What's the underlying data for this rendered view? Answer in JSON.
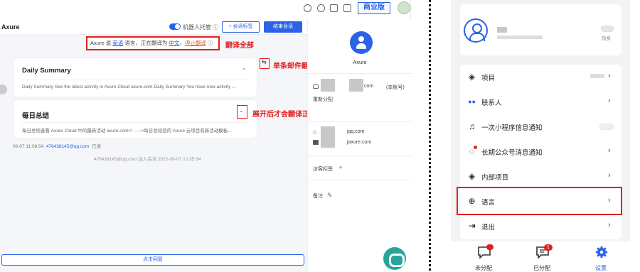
{
  "desktop": {
    "topbar": {
      "plan_button": "商业版"
    },
    "chat": {
      "title": "Axure",
      "robot_label": "机器人托管 ⓘ",
      "session_tag_button": "+ 会话标签",
      "end_button": "结束会话",
      "translate_bar": {
        "prefix": "Axure 说 ",
        "src_lang": "英语",
        "middle": " 语言，正在翻译为 ",
        "target_lang": "中文",
        "sep": "，",
        "stop": "停止翻译",
        "suffix": " ⓘ"
      },
      "annotations": {
        "translate_all": "翻译全部",
        "single_email": "单条邮件翻译",
        "expand_translate": "展开后才会翻译正文"
      },
      "message": {
        "original_title": "Daily Summary",
        "original_body": "Daily Summary See the latest activity in Axure Cloud axure.com Daily Summary You have new activity ...",
        "translated_title": "每日总结",
        "translated_body": "每日总结查看 Axure Cloud 中的最新活动 axure.com<! -- -->每日总结您的 Axure 云项目有新活动模板...",
        "meta": "06-07 11:08:54",
        "sender": "476438145@qq.com",
        "read_status": "已读"
      },
      "system_notice": "476438145@qq.com 加入会话 2022-06-07 10:35:34",
      "reply_button": "点击回复"
    },
    "info": {
      "name": "Axure",
      "account_suffix": "com",
      "account_tag": "(本账号)",
      "reassign": "重新分配",
      "email1": "jqq.com",
      "email2": "jaxure.com",
      "visitor_tag_label": "访客标签",
      "visitor_tag_add": "+",
      "note_label": "备注",
      "note_edit": "✎"
    }
  },
  "mobile": {
    "profile": {
      "hidden_label": "隐身"
    },
    "menu": [
      {
        "icon": "layers-icon",
        "label": "项目"
      },
      {
        "icon": "contacts-icon",
        "label": "联系人"
      },
      {
        "icon": "bell-icon",
        "label": "一次小程序信息通知"
      },
      {
        "icon": "chat-bubble-icon",
        "label": "长期公众号消息通知"
      },
      {
        "icon": "layers-icon",
        "label": "内部项目"
      },
      {
        "icon": "globe-icon",
        "label": "语言"
      },
      {
        "icon": "logout-icon",
        "label": "退出"
      }
    ],
    "tabs": [
      {
        "label": "未分配",
        "badge": ""
      },
      {
        "label": "已分配",
        "badge": "1"
      },
      {
        "label": "设置",
        "badge": ""
      }
    ],
    "colors": {
      "accent": "#2b62e8",
      "highlight": "#e02020"
    }
  }
}
